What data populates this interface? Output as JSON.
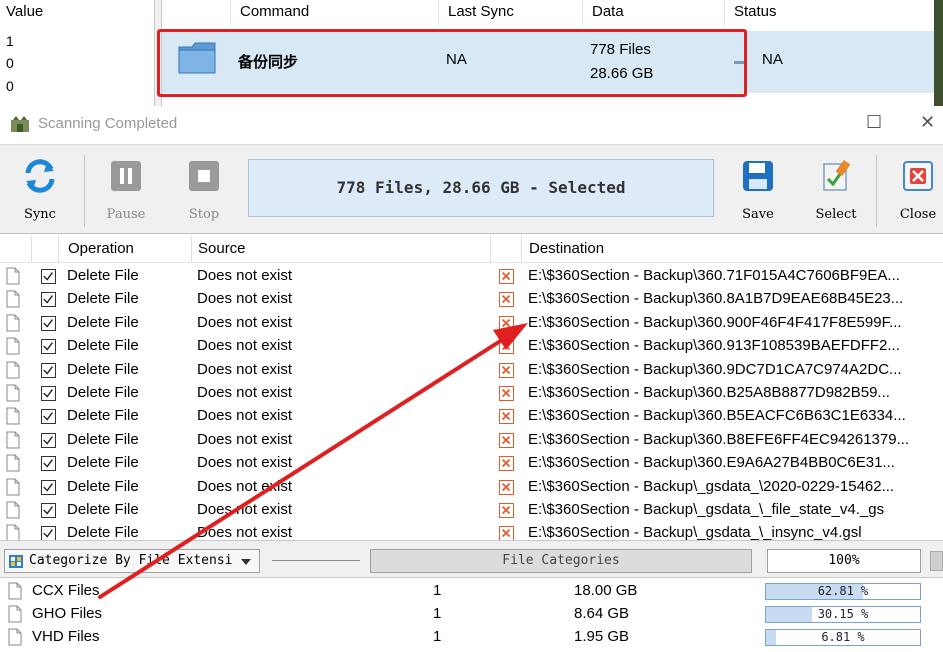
{
  "background_window": {
    "value_header": "Value",
    "values": [
      "1",
      "0",
      "0"
    ],
    "columns": [
      "Command",
      "Last Sync",
      "Data",
      "Status"
    ],
    "job": {
      "name": "备份同步",
      "last_sync": "NA",
      "files": "778 Files",
      "size": "28.66 GB",
      "status": "NA"
    }
  },
  "dialog": {
    "title": "Scanning Completed",
    "toolbar": {
      "sync": "Sync",
      "pause": "Pause",
      "stop": "Stop",
      "status": "778 Files, 28.66 GB - Selected",
      "save": "Save",
      "select": "Select",
      "close": "Close"
    },
    "operations": {
      "headers": {
        "operation": "Operation",
        "source": "Source",
        "destination": "Destination"
      },
      "rows": [
        {
          "operation": "Delete File",
          "source": "Does not exist",
          "destination": "E:\\$360Section - Backup\\360.71F015A4C7606BF9EA..."
        },
        {
          "operation": "Delete File",
          "source": "Does not exist",
          "destination": "E:\\$360Section - Backup\\360.8A1B7D9EAE68B45E23..."
        },
        {
          "operation": "Delete File",
          "source": "Does not exist",
          "destination": "E:\\$360Section - Backup\\360.900F46F4F417F8E599F..."
        },
        {
          "operation": "Delete File",
          "source": "Does not exist",
          "destination": "E:\\$360Section - Backup\\360.913F108539BAEFDFF2..."
        },
        {
          "operation": "Delete File",
          "source": "Does not exist",
          "destination": "E:\\$360Section - Backup\\360.9DC7D1CA7C974A2DC..."
        },
        {
          "operation": "Delete File",
          "source": "Does not exist",
          "destination": "E:\\$360Section - Backup\\360.B25A8B8877D982B59..."
        },
        {
          "operation": "Delete File",
          "source": "Does not exist",
          "destination": "E:\\$360Section - Backup\\360.B5EACFC6B63C1E6334..."
        },
        {
          "operation": "Delete File",
          "source": "Does not exist",
          "destination": "E:\\$360Section - Backup\\360.B8EFE6FF4EC94261379..."
        },
        {
          "operation": "Delete File",
          "source": "Does not exist",
          "destination": "E:\\$360Section - Backup\\360.E9A6A27B4BB0C6E31..."
        },
        {
          "operation": "Delete File",
          "source": "Does not exist",
          "destination": "E:\\$360Section - Backup\\_gsdata_\\2020-0229-15462..."
        },
        {
          "operation": "Delete File",
          "source": "Does not exist",
          "destination": "E:\\$360Section - Backup\\_gsdata_\\_file_state_v4._gs"
        },
        {
          "operation": "Delete File",
          "source": "Does not exist",
          "destination": "E:\\$360Section - Backup\\_gsdata_\\_insync_v4.gsl"
        }
      ]
    },
    "categories_bar": {
      "select_label": "Categorize By File Extensi",
      "file_categories_button": "File Categories",
      "percent": "100%"
    },
    "categories": [
      {
        "name": "CCX Files",
        "count": "1",
        "size": "18.00 GB",
        "percent_label": "62.81 %",
        "percent": 62.81
      },
      {
        "name": "GHO Files",
        "count": "1",
        "size": "8.64 GB",
        "percent_label": "30.15 %",
        "percent": 30.15
      },
      {
        "name": "VHD Files",
        "count": "1",
        "size": "1.95 GB",
        "percent_label": "6.81 %",
        "percent": 6.81
      }
    ]
  },
  "colors": {
    "annotation": "#e02020",
    "selection": "#d9e8f5",
    "status_panel": "#dcebf7"
  }
}
